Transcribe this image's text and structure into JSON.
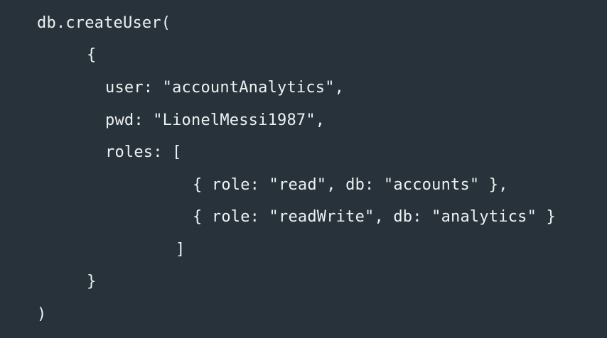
{
  "code": {
    "lines": [
      "db.createUser(",
      "{",
      "user: \"accountAnalytics\",",
      "pwd: \"LionelMessi1987\",",
      "roles: [",
      "{ role: \"read\", db: \"accounts\" },",
      "{ role: \"readWrite\", db: \"analytics\" }",
      "]",
      "}",
      ")"
    ]
  },
  "colors": {
    "background": "#27323a",
    "text": "#eef1f2"
  }
}
